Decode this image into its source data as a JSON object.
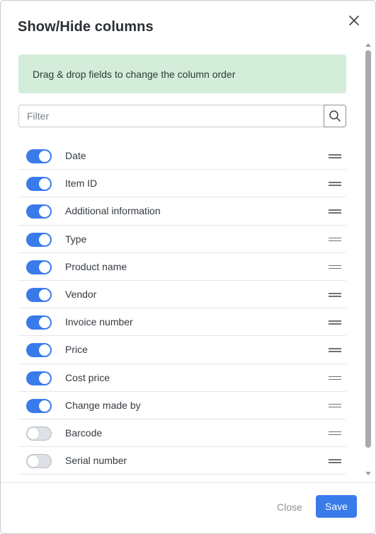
{
  "dialog": {
    "title": "Show/Hide columns",
    "close_icon": "close-icon"
  },
  "info": {
    "message": "Drag & drop fields to change the column order"
  },
  "filter": {
    "placeholder": "Filter",
    "value": "",
    "icon": "search-icon"
  },
  "columns": [
    {
      "label": "Date",
      "enabled": true
    },
    {
      "label": "Item ID",
      "enabled": true
    },
    {
      "label": "Additional information",
      "enabled": true
    },
    {
      "label": "Type",
      "enabled": true
    },
    {
      "label": "Product name",
      "enabled": true
    },
    {
      "label": "Vendor",
      "enabled": true
    },
    {
      "label": "Invoice number",
      "enabled": true
    },
    {
      "label": "Price",
      "enabled": true
    },
    {
      "label": "Cost price",
      "enabled": true
    },
    {
      "label": "Change made by",
      "enabled": true
    },
    {
      "label": "Barcode",
      "enabled": false
    },
    {
      "label": "Serial number",
      "enabled": false
    }
  ],
  "footer": {
    "close_label": "Close",
    "save_label": "Save"
  },
  "colors": {
    "accent": "#3a7bea",
    "info_bg": "#d4edda"
  }
}
